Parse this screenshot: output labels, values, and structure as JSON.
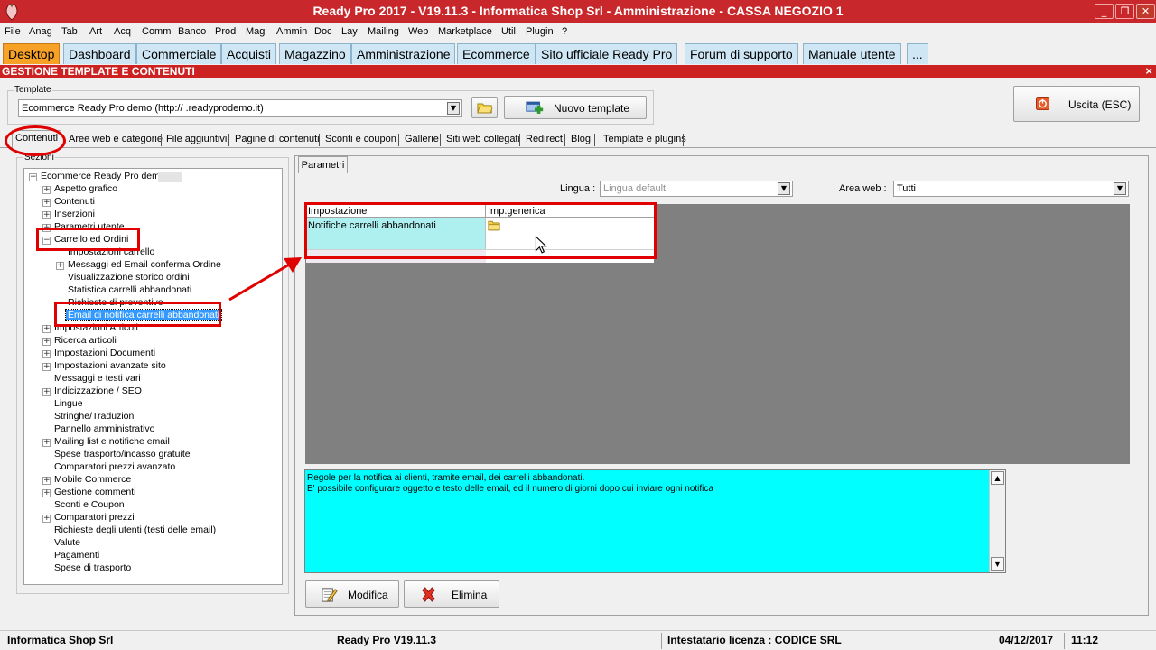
{
  "window": {
    "title": "Ready Pro 2017 - V19.11.3 - Informatica Shop Srl - Amministrazione - CASSA NEGOZIO 1",
    "controls": [
      "_",
      "❐",
      "✕"
    ]
  },
  "menu": [
    "File",
    "Anag",
    "Tab",
    "Art",
    "Acq",
    "Comm",
    "Banco",
    "Prod",
    "Mag",
    "Ammin",
    "Doc",
    "Lay",
    "Mailing",
    "Web",
    "Marketplace",
    "Util",
    "Plugin",
    "?"
  ],
  "main_tabs": [
    "Desktop",
    "Dashboard",
    "Commerciale",
    "Acquisti",
    "Magazzino",
    "Amministrazione",
    "Ecommerce",
    "Sito ufficiale Ready Pro",
    "Forum di supporto",
    "Manuale utente",
    "..."
  ],
  "section": {
    "title": "GESTIONE TEMPLATE E CONTENUTI",
    "close": "×"
  },
  "template": {
    "group_label": "Template",
    "value": "Ecommerce Ready Pro demo      (http://      .readyprodemo.it)",
    "new_button": "Nuovo template",
    "exit_button": "Uscita (ESC)"
  },
  "sub_tabs": [
    "Contenuti",
    "Aree web e categorie",
    "File aggiuntivi",
    "Pagine di contenuti",
    "Sconti e coupon",
    "Gallerie",
    "Siti web collegati",
    "Redirect",
    "Blog",
    "Template e plugins"
  ],
  "tree": {
    "group_label": "Sezioni",
    "root": "Ecommerce Ready Pro demo",
    "items": [
      {
        "label": "Aspetto grafico",
        "level": 1,
        "exp": "+"
      },
      {
        "label": "Contenuti",
        "level": 1,
        "exp": "+"
      },
      {
        "label": "Inserzioni",
        "level": 1,
        "exp": "+"
      },
      {
        "label": "Parametri utente",
        "level": 1,
        "exp": "+"
      },
      {
        "label": "Carrello ed Ordini",
        "level": 1,
        "exp": "−"
      },
      {
        "label": "Impostazioni carrello",
        "level": 2,
        "exp": ""
      },
      {
        "label": "Messaggi ed Email conferma Ordine",
        "level": 2,
        "exp": "+"
      },
      {
        "label": "Visualizzazione storico ordini",
        "level": 2,
        "exp": ""
      },
      {
        "label": "Statistica carrelli abbandonati",
        "level": 2,
        "exp": ""
      },
      {
        "label": "Richieste di preventivo",
        "level": 2,
        "exp": ""
      },
      {
        "label": "Email di notifica carrelli abbandonati",
        "level": 2,
        "exp": "",
        "selected": true
      },
      {
        "label": "Impostazioni Articoli",
        "level": 1,
        "exp": "+"
      },
      {
        "label": "Ricerca articoli",
        "level": 1,
        "exp": "+"
      },
      {
        "label": "Impostazioni Documenti",
        "level": 1,
        "exp": "+"
      },
      {
        "label": "Impostazioni avanzate sito",
        "level": 1,
        "exp": "+"
      },
      {
        "label": "Messaggi e testi vari",
        "level": 1,
        "exp": ""
      },
      {
        "label": "Indicizzazione / SEO",
        "level": 1,
        "exp": "+"
      },
      {
        "label": "Lingue",
        "level": 1,
        "exp": ""
      },
      {
        "label": "Stringhe/Traduzioni",
        "level": 1,
        "exp": ""
      },
      {
        "label": "Pannello amministrativo",
        "level": 1,
        "exp": ""
      },
      {
        "label": "Mailing list e notifiche email",
        "level": 1,
        "exp": "+"
      },
      {
        "label": "Spese trasporto/incasso gratuite",
        "level": 1,
        "exp": ""
      },
      {
        "label": "Comparatori prezzi avanzato",
        "level": 1,
        "exp": ""
      },
      {
        "label": "Mobile Commerce",
        "level": 1,
        "exp": "+"
      },
      {
        "label": "Gestione commenti",
        "level": 1,
        "exp": "+"
      },
      {
        "label": "Sconti e Coupon",
        "level": 1,
        "exp": ""
      },
      {
        "label": "Comparatori prezzi",
        "level": 1,
        "exp": "+"
      },
      {
        "label": "Richieste degli utenti (testi delle email)",
        "level": 1,
        "exp": ""
      },
      {
        "label": "Valute",
        "level": 1,
        "exp": ""
      },
      {
        "label": "Pagamenti",
        "level": 1,
        "exp": ""
      },
      {
        "label": "Spese di trasporto",
        "level": 1,
        "exp": ""
      }
    ]
  },
  "params": {
    "tab": "Parametri",
    "lingua_label": "Lingua :",
    "lingua_value": "Lingua default",
    "area_label": "Area web :",
    "area_value": "Tutti",
    "columns": [
      "Impostazione",
      "Imp.generica"
    ],
    "rows": [
      {
        "setting": "Notifiche carrelli abbandonati"
      }
    ],
    "description": "Regole per la notifica ai clienti, tramite email, dei carrelli abbandonati.\nE' possibile configurare oggetto e testo delle email, ed il numero di giorni dopo cui inviare ogni notifica",
    "modify_button": "Modifica",
    "delete_button": "Elimina"
  },
  "status": {
    "company": "Informatica Shop Srl",
    "version": "Ready Pro V19.11.3",
    "license": "Intestatario licenza : CODICE SRL",
    "date": "04/12/2017",
    "time": "11:12"
  },
  "colors": {
    "title_bar": "#c8282b",
    "active_tab": "#f7a127",
    "tab": "#cfe6f5",
    "section_header": "#cc2222",
    "description_bg": "#00ffff",
    "annotation": "#e00000"
  }
}
